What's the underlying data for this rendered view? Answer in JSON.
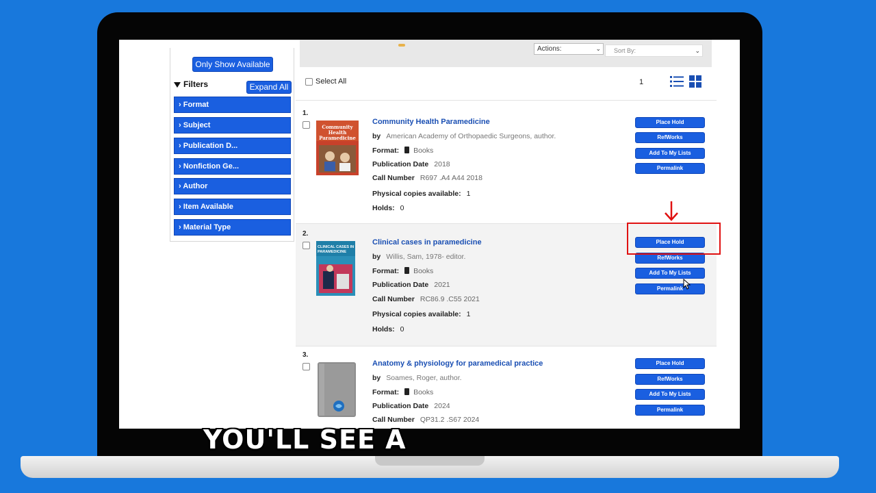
{
  "sidebar": {
    "only_available_label": "Only Show Available",
    "filters_label": "Filters",
    "expand_all_label": "Expand All",
    "facets": [
      {
        "label": "Format"
      },
      {
        "label": "Subject"
      },
      {
        "label": "Publication D..."
      },
      {
        "label": "Nonfiction Ge..."
      },
      {
        "label": "Author"
      },
      {
        "label": "Item Available"
      },
      {
        "label": "Material Type"
      }
    ]
  },
  "toolbar": {
    "actions_label": "Actions:",
    "sort_label": "Sort By:",
    "select_all_label": "Select All",
    "page_count": "1"
  },
  "labels": {
    "by": "by",
    "format": "Format:",
    "pub_date": "Publication Date",
    "call_number": "Call Number",
    "copies": "Physical copies available:",
    "holds": "Holds:"
  },
  "buttons": {
    "place_hold": "Place Hold",
    "refworks": "RefWorks",
    "add_to_lists": "Add To My Lists",
    "permalink": "Permalink"
  },
  "results": [
    {
      "number": "1.",
      "title": "Community Health Paramedicine",
      "author": "American Academy of Orthopaedic Surgeons, author.",
      "format": "Books",
      "pub_date": "2018",
      "call_number": "R697 .A4 A44 2018",
      "copies": "1",
      "holds": "0",
      "cover_text": "Community Health Paramedicine"
    },
    {
      "number": "2.",
      "title": "Clinical cases in paramedicine",
      "author": "Willis, Sam, 1978- editor.",
      "format": "Books",
      "pub_date": "2021",
      "call_number": "RC86.9 .C55 2021",
      "copies": "1",
      "holds": "0",
      "cover_text": "CLINICAL CASES IN PARAMEDICINE"
    },
    {
      "number": "3.",
      "title": "Anatomy & physiology for paramedical practice",
      "author": "Soames, Roger, author.",
      "format": "Books",
      "pub_date": "2024",
      "call_number": "QP31.2 .S67 2024"
    }
  ],
  "caption": "YOU'LL SEE A",
  "colors": {
    "background": "#1878dc",
    "button_blue": "#1a5fe0",
    "link_blue": "#1a4fb3",
    "annotation_red": "#e01010"
  }
}
